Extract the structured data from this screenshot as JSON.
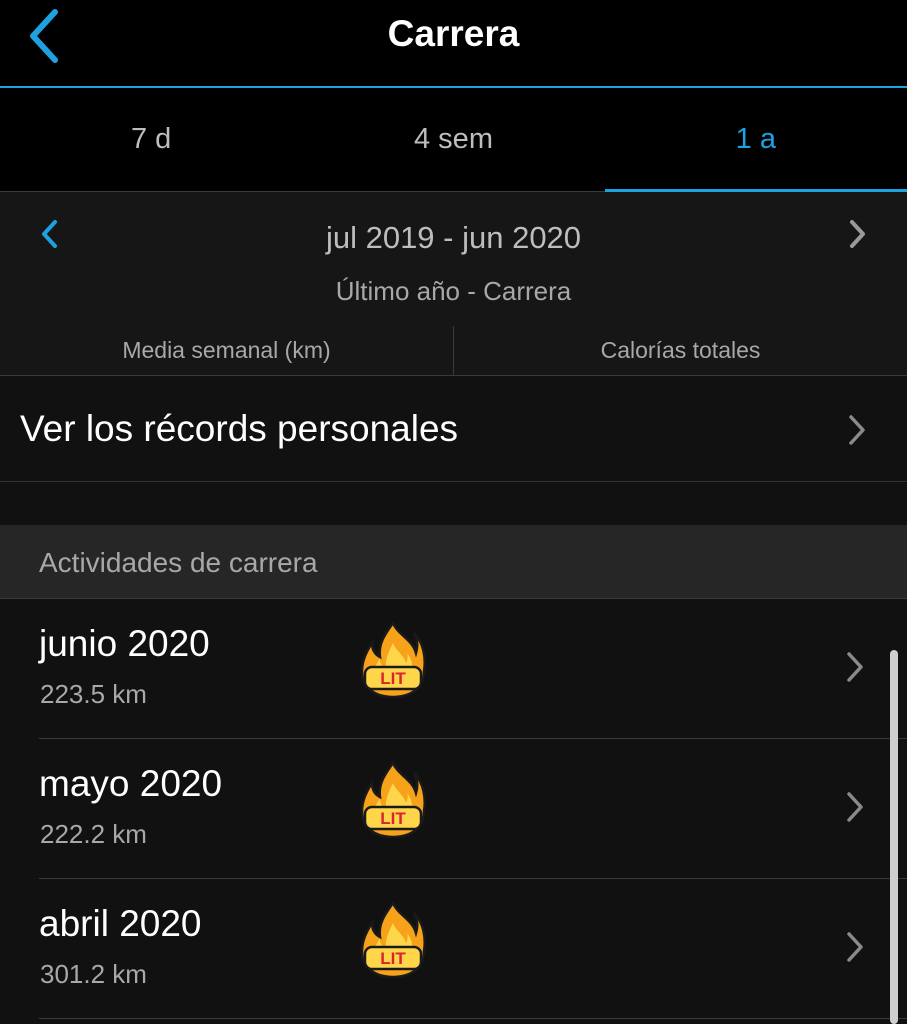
{
  "header": {
    "title": "Carrera",
    "back_icon": "chevron-left-icon"
  },
  "tabs": [
    {
      "label": "7 d",
      "active": false
    },
    {
      "label": "4 sem",
      "active": false
    },
    {
      "label": "1 a",
      "active": true
    }
  ],
  "range": {
    "dates": "jul 2019 - jun 2020",
    "subtitle": "Último año - Carrera"
  },
  "metrics": [
    "Media semanal (km)",
    "Calorías totales"
  ],
  "records": {
    "label": "Ver los récords personales"
  },
  "section": {
    "title": "Actividades de carrera"
  },
  "activities": [
    {
      "month": "junio 2020",
      "distance": "223.5 km",
      "badge": "lit-fire-icon",
      "badge_text": "LIT"
    },
    {
      "month": "mayo 2020",
      "distance": "222.2 km",
      "badge": "lit-fire-icon",
      "badge_text": "LIT"
    },
    {
      "month": "abril 2020",
      "distance": "301.2 km",
      "badge": "lit-fire-icon",
      "badge_text": "LIT"
    }
  ],
  "colors": {
    "accent": "#1ea1e0",
    "background": "#111111",
    "bar": "#000000"
  }
}
